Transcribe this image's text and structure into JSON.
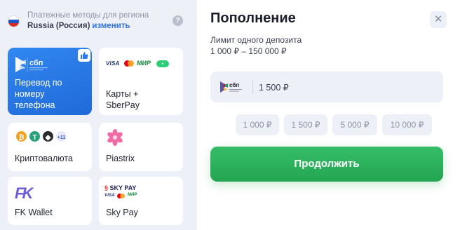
{
  "region": {
    "label": "Платежные методы для региона",
    "country": "Russia (Россия)",
    "change_link": "изменить",
    "flag_icon": "russia-flag-icon",
    "help_icon": "?"
  },
  "methods": [
    {
      "id": "sbp",
      "label_lines": [
        "Перевод по",
        "номеру",
        "телефона"
      ],
      "icon": "sbp-logo-icon",
      "logo_text": "сбп",
      "badge_icon": "thumbs-up-icon",
      "selected": true
    },
    {
      "id": "cards",
      "label_lines": [
        "Карты +",
        "SberPay"
      ],
      "icon_texts": {
        "visa": "VISA",
        "mir": "МИР"
      }
    },
    {
      "id": "crypto",
      "label_lines": [
        "Криптовалюта"
      ],
      "coins": [
        "₿",
        "T",
        "◆"
      ],
      "more": "+11"
    },
    {
      "id": "piastrix",
      "label_lines": [
        "Piastrix"
      ],
      "icon": "piastrix-flower-icon"
    },
    {
      "id": "fkwallet",
      "label_lines": [
        "FK Wallet"
      ],
      "logo_text": "FK"
    },
    {
      "id": "skypay",
      "label_lines": [
        "Sky Pay"
      ],
      "logo_text": "SKY PAY"
    }
  ],
  "panel": {
    "title": "Пополнение",
    "close_icon": "✕",
    "limit_label": "Лимит одного депозита",
    "limit_range": "1 000 ₽ – 150 000 ₽",
    "amount_value": "1 500 ₽",
    "presets": [
      "1 000 ₽",
      "1 500 ₽",
      "5 000 ₽",
      "10 000 ₽"
    ],
    "continue_label": "Продолжить"
  },
  "colors": {
    "accent_blue": "#2b7ae8",
    "continue_green": "#2eb05c",
    "background": "#eef0f7"
  }
}
